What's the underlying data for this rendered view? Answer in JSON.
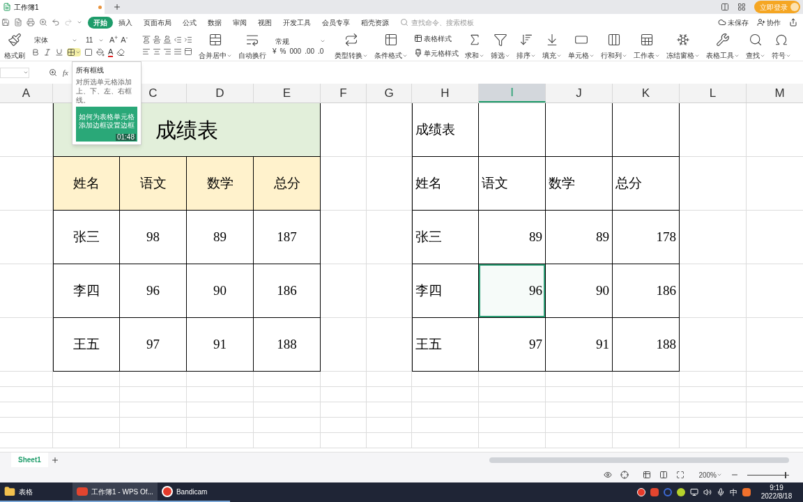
{
  "title_bar": {
    "doc_tab": {
      "title": "工作簿1",
      "unsaved": true
    },
    "login_button": "立即登录"
  },
  "menu_tabs": [
    {
      "label": "开始",
      "selected": true
    },
    {
      "label": "插入",
      "selected": false
    },
    {
      "label": "页面布局",
      "selected": false
    },
    {
      "label": "公式",
      "selected": false
    },
    {
      "label": "数据",
      "selected": false
    },
    {
      "label": "审阅",
      "selected": false
    },
    {
      "label": "视图",
      "selected": false
    },
    {
      "label": "开发工具",
      "selected": false
    },
    {
      "label": "会员专享",
      "selected": false
    },
    {
      "label": "稻壳资源",
      "selected": false
    }
  ],
  "search": {
    "placeholder": "查找命令、搜索模板"
  },
  "menu_right": {
    "save_status": "未保存",
    "collab": "协作"
  },
  "ribbon": {
    "format_painter": "格式刷",
    "font": "宋体",
    "font_size": "11",
    "font_grow": "A$^{+}$",
    "font_shrink": "A$^{-}$",
    "font_color": "A",
    "border_button_hovered": true,
    "merge": "合并居中",
    "wrap": "自动换行",
    "number_format": "常规",
    "number_buttons": [
      "¥",
      "%",
      "000",
      ".00",
      ".0"
    ],
    "convert": "类型转换",
    "conditional": "条件格式",
    "table_style": "表格样式",
    "cell_style": "单元格样式",
    "tools": [
      {
        "label": "求和"
      },
      {
        "label": "筛选"
      },
      {
        "label": "排序"
      },
      {
        "label": "填充"
      },
      {
        "label": "单元格"
      },
      {
        "label": "行和列"
      },
      {
        "label": "工作表"
      },
      {
        "label": "冻结窗格"
      },
      {
        "label": "表格工具"
      },
      {
        "label": "查找"
      },
      {
        "label": "符号"
      }
    ]
  },
  "formula_bar": {
    "fx": "fx"
  },
  "tooltip": {
    "title": "所有框线",
    "description": "对所选单元格添加上、下、左、右框线。",
    "video_title": "如何为表格单元格添加边框设置边框",
    "duration": "01:48"
  },
  "columns": [
    {
      "label": "A",
      "selected": false
    },
    {
      "label": "C",
      "selected": false
    },
    {
      "label": "D",
      "selected": false
    },
    {
      "label": "E",
      "selected": false
    },
    {
      "label": "F",
      "selected": false
    },
    {
      "label": "G",
      "selected": false
    },
    {
      "label": "H",
      "selected": false
    },
    {
      "label": "I",
      "selected": true
    },
    {
      "label": "J",
      "selected": false
    },
    {
      "label": "K",
      "selected": false
    },
    {
      "label": "L",
      "selected": false
    },
    {
      "label": "M",
      "selected": false
    }
  ],
  "left_table": {
    "title": "成绩表",
    "header": [
      "姓名",
      "语文",
      "数学",
      "总分"
    ],
    "rows": [
      [
        "张三",
        "98",
        "89",
        "187"
      ],
      [
        "李四",
        "96",
        "90",
        "186"
      ],
      [
        "王五",
        "97",
        "91",
        "188"
      ]
    ]
  },
  "right_table": {
    "title": "成绩表",
    "header": [
      "姓名",
      "语文",
      "数学",
      "总分"
    ],
    "rows": [
      {
        "cells": [
          {
            "text": "张三",
            "selected": false
          },
          {
            "text": "89",
            "selected": false
          },
          {
            "text": "89",
            "selected": false
          },
          {
            "text": "178",
            "selected": false
          }
        ]
      },
      {
        "cells": [
          {
            "text": "李四",
            "selected": false
          },
          {
            "text": "96",
            "selected": true
          },
          {
            "text": "90",
            "selected": false
          },
          {
            "text": "186",
            "selected": false
          }
        ]
      },
      {
        "cells": [
          {
            "text": "王五",
            "selected": false
          },
          {
            "text": "97",
            "selected": false
          },
          {
            "text": "91",
            "selected": false
          },
          {
            "text": "188",
            "selected": false
          }
        ]
      }
    ]
  },
  "sheet_tabs": [
    {
      "label": "Sheet1",
      "selected": true
    }
  ],
  "status_bar": {
    "zoom": "200%",
    "zoom_slider": {
      "level": 0.92
    }
  },
  "taskbar": {
    "items": [
      {
        "label": "表格",
        "selected": false,
        "kind": "folder"
      },
      {
        "label": "工作簿1 - WPS Of...",
        "selected": true,
        "kind": "wps"
      },
      {
        "label": "Bandicam",
        "selected": false,
        "kind": "record"
      }
    ],
    "ime": "中",
    "time": "9:19",
    "date": "2022/8/18"
  }
}
